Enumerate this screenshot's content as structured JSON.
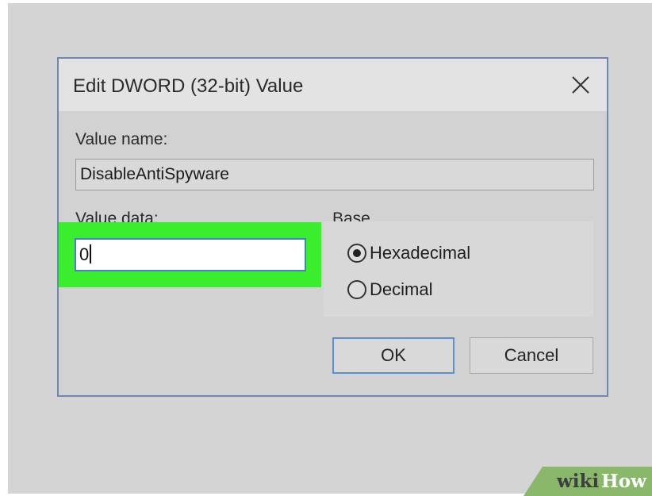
{
  "dialog": {
    "title": "Edit DWORD (32-bit) Value",
    "close_icon": "close-icon",
    "value_name_label": "Value name:",
    "value_name": "DisableAntiSpyware",
    "value_data_label": "Value data:",
    "value_data": "0",
    "base_label": "Base",
    "base_options": [
      {
        "label": "Hexadecimal",
        "selected": true
      },
      {
        "label": "Decimal",
        "selected": false
      }
    ],
    "ok_label": "OK",
    "cancel_label": "Cancel"
  },
  "highlight_color": "#3aee2e",
  "watermark": {
    "part1": "wiki",
    "part2": "How"
  }
}
